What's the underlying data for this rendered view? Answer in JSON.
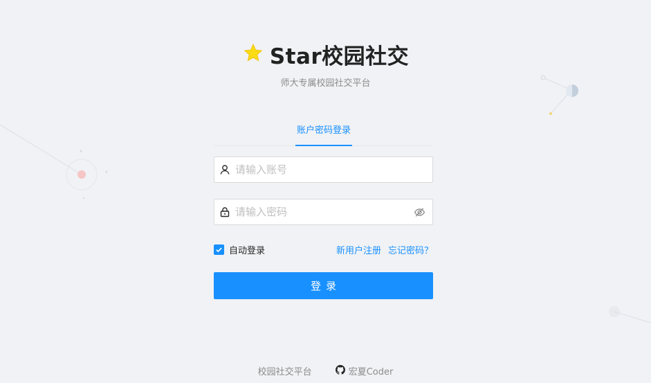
{
  "brand": {
    "title": "Star校园社交",
    "subtitle": "师大专属校园社交平台",
    "icon": "star-icon"
  },
  "tabs": [
    {
      "label": "账户密码登录",
      "active": true
    }
  ],
  "form": {
    "account_placeholder": "请输入账号",
    "password_placeholder": "请输入密码",
    "remember_label": "自动登录",
    "remember_checked": true,
    "register_link": "新用户注册",
    "forgot_link": "忘记密码？",
    "submit_label": "登录"
  },
  "footer": {
    "platform_link": "校园社交平台",
    "author_link": "宏夏Coder"
  },
  "colors": {
    "primary": "#1890ff",
    "background": "#f0f2f5",
    "star": "#fadb14"
  }
}
